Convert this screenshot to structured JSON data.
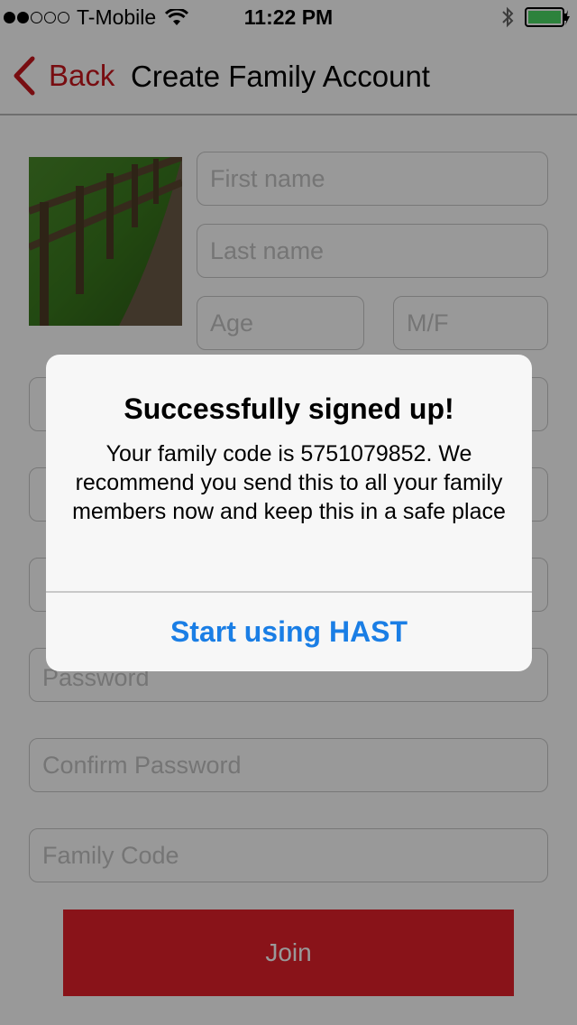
{
  "status_bar": {
    "signal_filled": 2,
    "signal_total": 5,
    "carrier": "T-Mobile",
    "time": "11:22 PM",
    "icons": [
      "wifi-icon",
      "bluetooth-icon",
      "battery-icon",
      "charging-bolt-icon"
    ]
  },
  "nav": {
    "back_label": "Back",
    "title": "Create Family Account",
    "accent_color": "#c8161d"
  },
  "form": {
    "photo_icon": "profile-photo",
    "first_name_placeholder": "First name",
    "last_name_placeholder": "Last name",
    "age_placeholder": "Age",
    "gender_placeholder": "M/F",
    "password_placeholder": "Password",
    "confirm_password_placeholder": "Confirm Password",
    "family_code_placeholder": "Family Code",
    "join_label": "Join",
    "join_color": "#e4212b"
  },
  "alert": {
    "title": "Successfully signed up!",
    "message": "Your family code is 5751079852. We recommend you send this to all your family members now and keep this in a safe place",
    "button_label": "Start using HAST",
    "button_color": "#1a7ee5"
  }
}
